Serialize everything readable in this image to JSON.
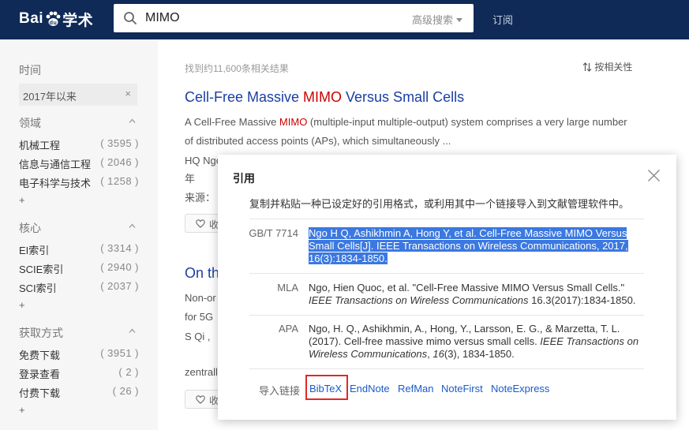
{
  "header": {
    "logo_text_1": "Bai",
    "logo_text_2": "学术",
    "search_value": "MIMO",
    "advanced_search": "高级搜索",
    "subscribe": "订阅"
  },
  "sidebar": {
    "time_title": "时间",
    "time_filter": "2017年以来",
    "clear_symbol": "×",
    "field_title": "领域",
    "fields": [
      {
        "label": "机械工程",
        "count": "( 3595 )"
      },
      {
        "label": "信息与通信工程",
        "count": "( 2046 )"
      },
      {
        "label": "电子科学与技术",
        "count": "( 1258 )"
      }
    ],
    "core_title": "核心",
    "cores": [
      {
        "label": "EI索引",
        "count": "( 3314 )"
      },
      {
        "label": "SCIE索引",
        "count": "( 2940 )"
      },
      {
        "label": "SCI索引",
        "count": "( 2037 )"
      }
    ],
    "access_title": "获取方式",
    "access": [
      {
        "label": "免费下载",
        "count": "( 3951 )"
      },
      {
        "label": "登录查看",
        "count": "( 2 )"
      },
      {
        "label": "付费下载",
        "count": "( 26 )"
      }
    ],
    "more": "+"
  },
  "results": {
    "found_text": "找到约11,600条相关结果",
    "sort_text": "按相关性",
    "r1": {
      "title_pre": "Cell-Free Massive ",
      "title_hl": "MIMO",
      "title_post": " Versus Small Cells",
      "abs1_pre": "A Cell-Free Massive ",
      "abs1_hl": "MIMO",
      "abs1_post": " (multiple-input multiple-output) system comprises a very large number",
      "abs2": "of distributed access points (APs), which simultaneously ...",
      "authors_partial": "HQ Ngo",
      "year_partial": "年",
      "source_partial": "来源：",
      "fav_partial": "收"
    },
    "r2": {
      "title_partial": "On th",
      "line1_partial": "Non-or",
      "line2_partial": "for 5G",
      "line3_partial": "S Qi ,",
      "line4_partial": "zentrall",
      "fav_partial": "收"
    }
  },
  "cite_modal": {
    "title": "引用",
    "description": "复制并粘贴一种已设定好的引用格式，或利用其中一个链接导入到文献管理软件中。",
    "formats": [
      {
        "name": "GB/T 7714",
        "lines": [
          "Ngo H Q, Ashikhmin A, Hong Y, et al. Cell-Free Massive MIMO Versus",
          "Small Cells[J]. IEEE Transactions on Wireless Communications, 2017,",
          "16(3):1834-1850."
        ]
      },
      {
        "name": "MLA",
        "line1": "Ngo, Hien Quoc, et al. \"Cell-Free Massive MIMO Versus Small Cells.\"",
        "line2_italic": "IEEE Transactions on Wireless Communications",
        "line2_rest": " 16.3(2017):1834-1850."
      },
      {
        "name": "APA",
        "line1": "Ngo, H. Q., Ashikhmin, A., Hong, Y., Larsson, E. G., & Marzetta, T. L.",
        "line2_pre": "(2017). Cell-free massive mimo versus small cells. ",
        "line2_italic": "IEEE Transactions on",
        "line3_italic_1": "Wireless Communications",
        "line3_mid": ", ",
        "line3_italic_2": "16",
        "line3_rest": "(3), 1834-1850."
      }
    ],
    "import_label": "导入链接",
    "import_links": [
      "BibTeX",
      "EndNote",
      "RefMan",
      "NoteFirst",
      "NoteExpress"
    ]
  },
  "colors": {
    "header_bg": "#0f2a57",
    "link_blue": "#1a3ea3",
    "highlight_red": "#cc0000",
    "selection_blue": "#3b78e0",
    "callout_red": "#e02828"
  },
  "icons": [
    "baidu-paw-icon",
    "search-icon",
    "chevron-up-icon",
    "sort-icon",
    "heart-icon",
    "close-icon"
  ]
}
